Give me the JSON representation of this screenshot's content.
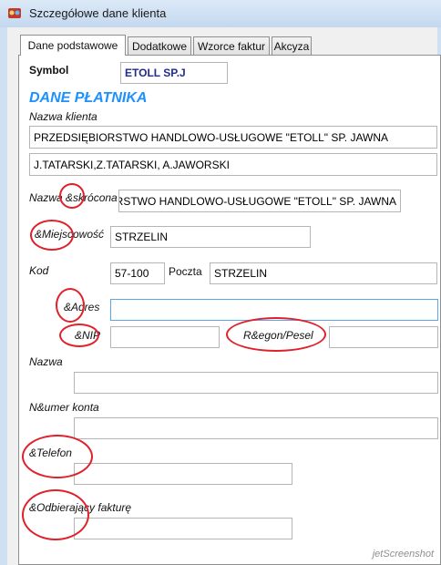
{
  "window": {
    "title": "Szczegółowe dane klienta"
  },
  "tabs": [
    {
      "label": "Dane podstawowe",
      "active": true
    },
    {
      "label": "Dodatkowe",
      "active": false
    },
    {
      "label": "Wzorce faktur",
      "active": false
    },
    {
      "label": "Akcyza",
      "active": false
    }
  ],
  "form": {
    "symbol_label": "Symbol",
    "symbol_value": "ETOLL SP.J",
    "section_title": "DANE PŁATNIKA",
    "nazwa_klienta_label": "Nazwa klienta",
    "nazwa_klienta_line1": "PRZEDSIĘBIORSTWO HANDLOWO-USŁUGOWE \"ETOLL\" SP. JAWNA",
    "nazwa_klienta_line2": "J.TATARSKI,Z.TATARSKI, A.JAWORSKI",
    "nazwa_skrocona_label": "Nazwa &skrócona",
    "nazwa_skrocona_value": "RSTWO HANDLOWO-USŁUGOWE \"ETOLL\" SP. JAWNA",
    "miejscowosc_label": "&Miejscowość",
    "miejscowosc_value": "STRZELIN",
    "kod_label": "Kod",
    "kod_value": "57-100",
    "poczta_label": "Poczta",
    "poczta_value": "STRZELIN",
    "adres_label": "&Adres",
    "adres_value": "",
    "nip_label": "&NIP",
    "nip_value": "",
    "regon_label": "R&egon/Pesel",
    "regon_value": "",
    "nazwa_label": "Nazwa",
    "nazwa_value": "",
    "numer_konta_label": "N&umer konta",
    "numer_konta_value": "",
    "telefon_label": "&Telefon",
    "telefon_value": "",
    "odbierajacy_label": "&Odbierający fakturę",
    "odbierajacy_value": ""
  },
  "watermark": "jetScreenshot",
  "colors": {
    "annotation": "#e0202a",
    "section_title": "#1e90ff",
    "symbol_text": "#1f2d8c"
  }
}
